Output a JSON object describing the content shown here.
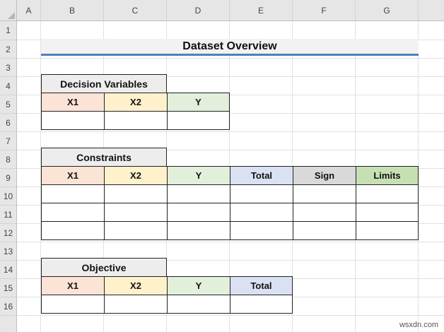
{
  "sheet": {
    "columns": [
      "A",
      "B",
      "C",
      "D",
      "E",
      "F",
      "G"
    ],
    "rows": [
      "1",
      "2",
      "3",
      "4",
      "5",
      "6",
      "7",
      "8",
      "9",
      "10",
      "11",
      "12",
      "13",
      "14",
      "15",
      "16"
    ]
  },
  "title": "Dataset Overview",
  "colors": {
    "x1": "#fbe3d6",
    "x2": "#fff1cc",
    "y": "#e2efda",
    "total": "#d9e1f2",
    "sign": "#d9d9d9",
    "limits": "#c6e0b4",
    "title_underline": "#4f7fbf"
  },
  "decision": {
    "label": "Decision Variables",
    "headers": [
      "X1",
      "X2",
      "Y"
    ]
  },
  "constraints": {
    "label": "Constraints",
    "headers": [
      "X1",
      "X2",
      "Y",
      "Total",
      "Sign",
      "Limits"
    ]
  },
  "objective": {
    "label": "Objective",
    "headers": [
      "X1",
      "X2",
      "Y",
      "Total"
    ]
  },
  "watermark": "wsxdn.com"
}
